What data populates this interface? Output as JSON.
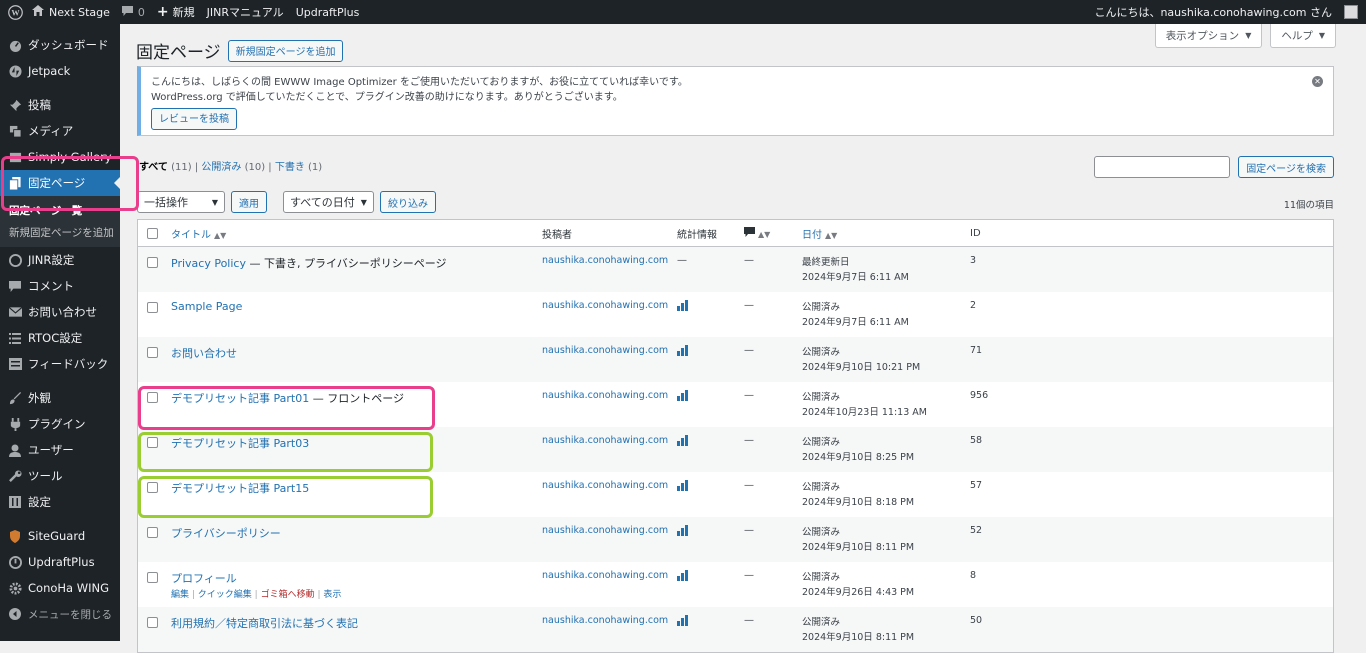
{
  "adminbar": {
    "site_name": "Next Stage",
    "comments_count": "0",
    "new_label": "新規",
    "menu_items": [
      "JINRマニュアル",
      "UpdraftPlus"
    ],
    "greeting": "こんにちは、naushika.conohawing.com さん"
  },
  "sidebar": {
    "items": [
      {
        "label": "ダッシュボード",
        "icon": "dashboard-icon"
      },
      {
        "label": "Jetpack",
        "icon": "jetpack-icon"
      },
      {
        "label": "投稿",
        "icon": "pin-icon"
      },
      {
        "label": "メディア",
        "icon": "media-icon"
      },
      {
        "label": "Simply Gallery",
        "icon": "gallery-icon"
      },
      {
        "label": "固定ページ",
        "icon": "page-icon"
      },
      {
        "label": "JINR設定",
        "icon": "jinr-icon"
      },
      {
        "label": "コメント",
        "icon": "comment-icon"
      },
      {
        "label": "お問い合わせ",
        "icon": "mail-icon"
      },
      {
        "label": "RTOC設定",
        "icon": "list-icon"
      },
      {
        "label": "フィードバック",
        "icon": "feedback-icon"
      },
      {
        "label": "外観",
        "icon": "brush-icon"
      },
      {
        "label": "プラグイン",
        "icon": "plugin-icon"
      },
      {
        "label": "ユーザー",
        "icon": "user-icon"
      },
      {
        "label": "ツール",
        "icon": "wrench-icon"
      },
      {
        "label": "設定",
        "icon": "settings-icon"
      },
      {
        "label": "SiteGuard",
        "icon": "siteguard-icon"
      },
      {
        "label": "UpdraftPlus",
        "icon": "updraft-icon"
      },
      {
        "label": "ConoHa WING",
        "icon": "gear-icon"
      },
      {
        "label": "メニューを閉じる",
        "icon": "collapse-icon"
      }
    ],
    "submenu": [
      "固定ページ一覧",
      "新規固定ページを追加"
    ]
  },
  "header": {
    "title": "固定ページ",
    "add_new": "新規固定ページを追加",
    "screen_options": "表示オプション",
    "help": "ヘルプ"
  },
  "notice": {
    "line1": "こんにちは、しばらくの間 EWWW Image Optimizer をご使用いただいておりますが、お役に立てていれば幸いです。",
    "line2": "WordPress.org で評価していただくことで、プラグイン改善の助けになります。ありがとうございます。",
    "button": "レビューを投稿"
  },
  "filters": {
    "all_label": "すべて",
    "all_count": "(11)",
    "published_label": "公開済み",
    "published_count": "(10)",
    "draft_label": "下書き",
    "draft_count": "(1)",
    "sep": "|"
  },
  "search": {
    "button": "固定ページを検索"
  },
  "tablenav": {
    "bulk": "一括操作",
    "apply": "適用",
    "dates": "すべての日付",
    "filter": "絞り込み",
    "count": "11個の項目"
  },
  "table": {
    "headers": {
      "title": "タイトル",
      "author": "投稿者",
      "stats": "統計情報",
      "date": "日付",
      "id": "ID"
    },
    "rows": [
      {
        "title": "Privacy Policy",
        "state": " — 下書き, プライバシーポリシーページ",
        "author": "naushika.conohawing.com",
        "stats": "—",
        "comments": "—",
        "status": "最終更新日",
        "date": "2024年9月7日 6:11 AM",
        "id": "3"
      },
      {
        "title": "Sample Page",
        "state": "",
        "author": "naushika.conohawing.com",
        "stats": "bars",
        "comments": "—",
        "status": "公開済み",
        "date": "2024年9月7日 6:11 AM",
        "id": "2"
      },
      {
        "title": "お問い合わせ",
        "state": "",
        "author": "naushika.conohawing.com",
        "stats": "bars",
        "comments": "—",
        "status": "公開済み",
        "date": "2024年9月10日 10:21 PM",
        "id": "71"
      },
      {
        "title": "デモプリセット記事 Part01",
        "state": " — フロントページ",
        "author": "naushika.conohawing.com",
        "stats": "bars",
        "comments": "—",
        "status": "公開済み",
        "date": "2024年10月23日 11:13 AM",
        "id": "956"
      },
      {
        "title": "デモプリセット記事 Part03",
        "state": "",
        "author": "naushika.conohawing.com",
        "stats": "bars",
        "comments": "—",
        "status": "公開済み",
        "date": "2024年9月10日 8:25 PM",
        "id": "58"
      },
      {
        "title": "デモプリセット記事 Part15",
        "state": "",
        "author": "naushika.conohawing.com",
        "stats": "bars",
        "comments": "—",
        "status": "公開済み",
        "date": "2024年9月10日 8:18 PM",
        "id": "57"
      },
      {
        "title": "プライバシーポリシー",
        "state": "",
        "author": "naushika.conohawing.com",
        "stats": "bars",
        "comments": "—",
        "status": "公開済み",
        "date": "2024年9月10日 8:11 PM",
        "id": "52"
      },
      {
        "title": "プロフィール",
        "state": "",
        "author": "naushika.conohawing.com",
        "stats": "bars",
        "comments": "—",
        "status": "公開済み",
        "date": "2024年9月26日 4:43 PM",
        "id": "8"
      },
      {
        "title": "利用規約／特定商取引法に基づく表記",
        "state": "",
        "author": "naushika.conohawing.com",
        "stats": "bars",
        "comments": "—",
        "status": "公開済み",
        "date": "2024年9月10日 8:11 PM",
        "id": "50"
      }
    ],
    "row_actions": {
      "edit": "編集",
      "quick_edit": "クイック編集",
      "trash": "ゴミ箱へ移動",
      "view": "表示",
      "sep": " | "
    }
  },
  "colors": {
    "accent": "#2271b1",
    "sidebar": "#1d2327",
    "highlight_pink": "#e83e8c",
    "highlight_green": "#9acd32"
  }
}
